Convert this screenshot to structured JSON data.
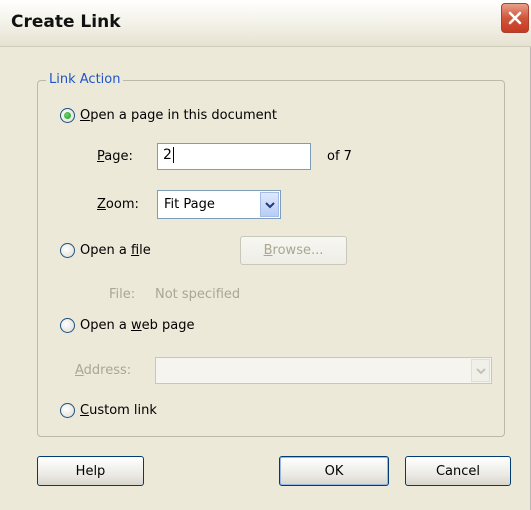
{
  "dialog": {
    "title": "Create Link",
    "close_icon": "close-x-icon"
  },
  "group": {
    "legend": "Link Action"
  },
  "options": {
    "page_in_doc": {
      "underline": "O",
      "rest": "pen a page in this document",
      "checked": true
    },
    "open_file": {
      "pre": "Open a ",
      "underline": "f",
      "rest": "ile",
      "checked": false
    },
    "web_page": {
      "pre": "Open a ",
      "underline": "w",
      "rest": "eb page",
      "checked": false
    },
    "custom_link": {
      "underline": "C",
      "rest": "ustom link",
      "checked": false
    }
  },
  "page_field": {
    "label_underline": "P",
    "label_rest": "age:",
    "value": "2",
    "of_text": "of 7"
  },
  "zoom_field": {
    "label_underline": "Z",
    "label_rest": "oom:",
    "selected": "Fit Page"
  },
  "file_field": {
    "browse_pre": "",
    "browse_underline": "B",
    "browse_rest": "rowse...",
    "label": "File:",
    "value": "Not specified"
  },
  "address_field": {
    "label_underline": "A",
    "label_rest": "ddress:",
    "value": ""
  },
  "buttons": {
    "help": "Help",
    "ok": "OK",
    "cancel": "Cancel"
  }
}
